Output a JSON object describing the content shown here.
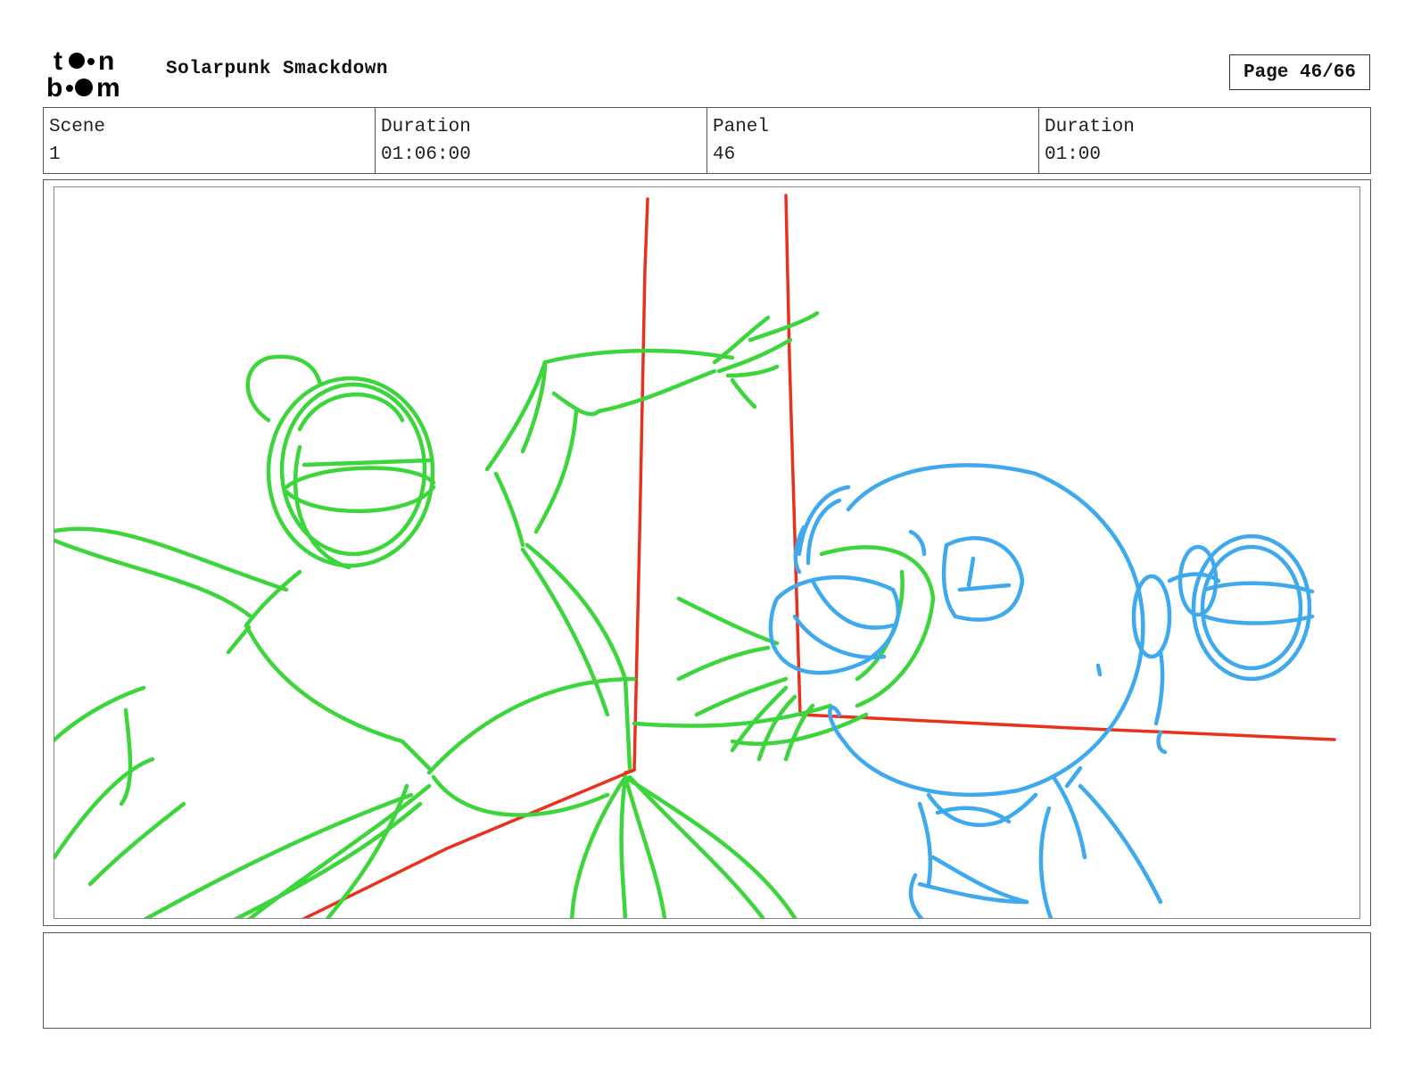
{
  "header": {
    "logo_text": "toon boom",
    "project_title": "Solarpunk Smackdown",
    "page_label": "Page",
    "page_value": "46/66"
  },
  "meta": {
    "scene_label": "Scene",
    "scene_value": "1",
    "scene_duration_label": "Duration",
    "scene_duration_value": "01:06:00",
    "panel_label": "Panel",
    "panel_value": "46",
    "panel_duration_label": "Duration",
    "panel_duration_value": "01:00"
  },
  "sketch": {
    "colors": {
      "character_a": "#3cd63c",
      "character_b": "#3fa9ee",
      "guides": "#e8321e"
    }
  },
  "notes": {
    "text": ""
  }
}
